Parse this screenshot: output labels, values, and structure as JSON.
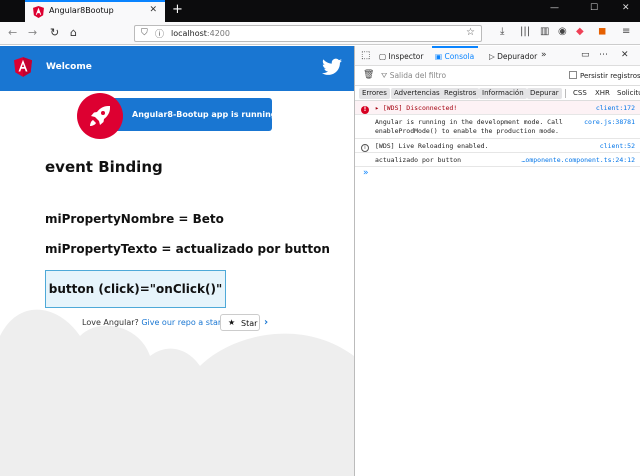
{
  "browser": {
    "tab_title": "Angular8Bootup",
    "tab_close_icon": "close-icon",
    "new_tab_icon": "plus-icon",
    "url_host": "localhost",
    "url_port": ":4200",
    "window_controls": [
      "minimize-icon",
      "maximize-icon",
      "close-icon"
    ],
    "nav_icons": [
      "back-arrow-icon",
      "forward-arrow-icon",
      "reload-icon",
      "home-icon"
    ],
    "toolbar_icons": [
      "download-icon",
      "library-icon",
      "sidebar-icon",
      "sync-icon",
      "pocket-icon",
      "extension-icon",
      "menu-icon"
    ]
  },
  "app": {
    "header_title": "Welcome",
    "card_text": "Angular8-Bootup app is running!",
    "heading": "event Binding",
    "property_nombre": "miPropertyNombre = Beto",
    "property_texto": "miPropertyTexto = actualizado por button",
    "button_label": "button (click)=\"onClick()\"",
    "love_text": "Love Angular?",
    "love_link": "Give our repo a star.",
    "star_label": "Star",
    "brand_color": "#1976d2",
    "angular_color": "#dd0031"
  },
  "devtools": {
    "tabs": {
      "inspector": "Inspector",
      "console": "Consola",
      "debugger": "Depurador"
    },
    "filter_placeholder": "Salida del filtro",
    "persist_logs": "Persistir registros",
    "levels": {
      "errors": "Errores",
      "warnings": "Advertencias",
      "logs": "Registros",
      "info": "Información",
      "debug": "Depurar",
      "css": "CSS",
      "xhr": "XHR",
      "requests": "Solicitu"
    },
    "messages": [
      {
        "type": "error",
        "text": "[WDS] Disconnected!",
        "source": "client:172"
      },
      {
        "type": "log",
        "text": "Angular is running in the development mode. Call\nenableProdMode() to enable the production mode.",
        "source": "core.js:38781"
      },
      {
        "type": "info",
        "text": "[WDS] Live Reloading enabled.",
        "source": "client:52"
      },
      {
        "type": "log",
        "text": "actualizado por button",
        "source": "…omponente.component.ts:24:12"
      }
    ],
    "prompt": "»"
  }
}
